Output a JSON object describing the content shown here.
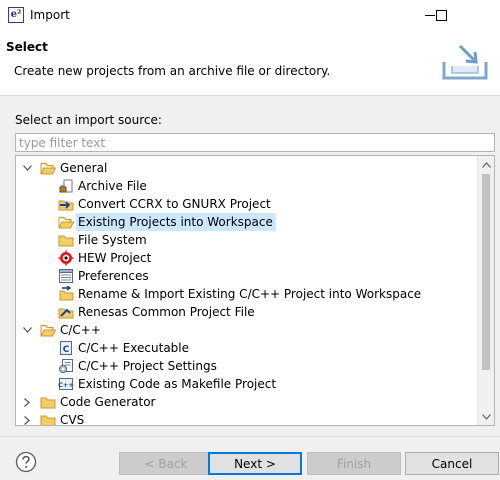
{
  "window": {
    "title": "Import",
    "icon": "eclipse-e2-icon",
    "minimize_icon": "minimize-icon",
    "maximize_icon": "maximize-icon"
  },
  "header": {
    "title": "Select",
    "description": "Create new projects from an archive file or directory.",
    "graphic": "import-wizard-icon"
  },
  "source": {
    "label": "Select an import source:",
    "filter_placeholder": "type filter text",
    "filter_value": ""
  },
  "tree": {
    "selected_index": 3,
    "items": [
      {
        "label": "General",
        "level": 0,
        "expander": "expanded",
        "icon": "folder-open-icon"
      },
      {
        "label": "Archive File",
        "level": 1,
        "expander": "",
        "icon": "archive-file-icon"
      },
      {
        "label": "Convert CCRX to GNURX Project",
        "level": 1,
        "expander": "",
        "icon": "convert-project-icon"
      },
      {
        "label": "Existing Projects into Workspace",
        "level": 1,
        "expander": "",
        "icon": "folder-open-icon"
      },
      {
        "label": "File System",
        "level": 1,
        "expander": "",
        "icon": "folder-icon"
      },
      {
        "label": "HEW Project",
        "level": 1,
        "expander": "",
        "icon": "hew-project-icon"
      },
      {
        "label": "Preferences",
        "level": 1,
        "expander": "",
        "icon": "preferences-icon"
      },
      {
        "label": "Rename & Import Existing C/C++ Project into Workspace",
        "level": 1,
        "expander": "",
        "icon": "rename-import-icon"
      },
      {
        "label": "Renesas Common Project File",
        "level": 1,
        "expander": "",
        "icon": "renesas-project-icon"
      },
      {
        "label": "C/C++",
        "level": 0,
        "expander": "expanded",
        "icon": "folder-open-icon"
      },
      {
        "label": "C/C++ Executable",
        "level": 1,
        "expander": "",
        "icon": "c-executable-icon"
      },
      {
        "label": "C/C++ Project Settings",
        "level": 1,
        "expander": "",
        "icon": "project-settings-icon"
      },
      {
        "label": "Existing Code as Makefile Project",
        "level": 1,
        "expander": "",
        "icon": "makefile-project-icon"
      },
      {
        "label": "Code Generator",
        "level": 0,
        "expander": "collapsed",
        "icon": "folder-icon"
      },
      {
        "label": "CVS",
        "level": 0,
        "expander": "collapsed",
        "icon": "folder-icon"
      }
    ]
  },
  "buttons": {
    "help_icon": "help-icon",
    "back": "< Back",
    "next": "Next >",
    "finish": "Finish",
    "cancel": "Cancel"
  },
  "colors": {
    "selection": "#cce8ff",
    "default_button_border": "#0078d7",
    "folder": "#e8b74a"
  }
}
